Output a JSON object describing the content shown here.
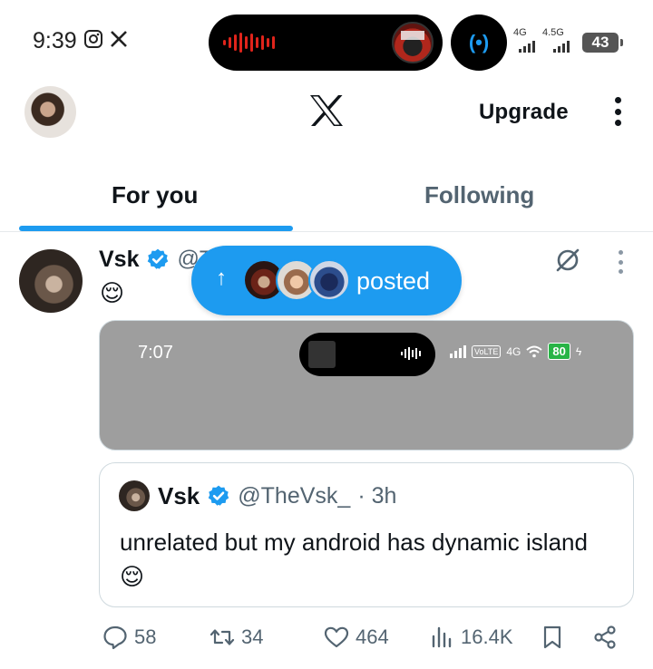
{
  "status_bar": {
    "time": "9:39",
    "net1": "4G",
    "net2": "4.5G",
    "battery": "43"
  },
  "header": {
    "upgrade_label": "Upgrade"
  },
  "tabs": [
    {
      "label": "For you",
      "active": true
    },
    {
      "label": "Following",
      "active": false
    }
  ],
  "tweet": {
    "name": "Vsk",
    "handle": "@T",
    "emoji": "😌",
    "posted_label": "posted",
    "media": {
      "time": "7:07",
      "volte": "VoLTE",
      "net": "4G",
      "battery": "80"
    },
    "quote": {
      "name": "Vsk",
      "handle": "@TheVsk_",
      "time": "· 3h",
      "text": "unrelated but my android has dynamic island 😌"
    },
    "stats": {
      "replies": "58",
      "retweets": "34",
      "likes": "464",
      "views": "16.4K"
    }
  },
  "colors": {
    "accent": "#1d9bf0",
    "secondary_text": "#536471",
    "media_bg": "#9e9e9e"
  }
}
